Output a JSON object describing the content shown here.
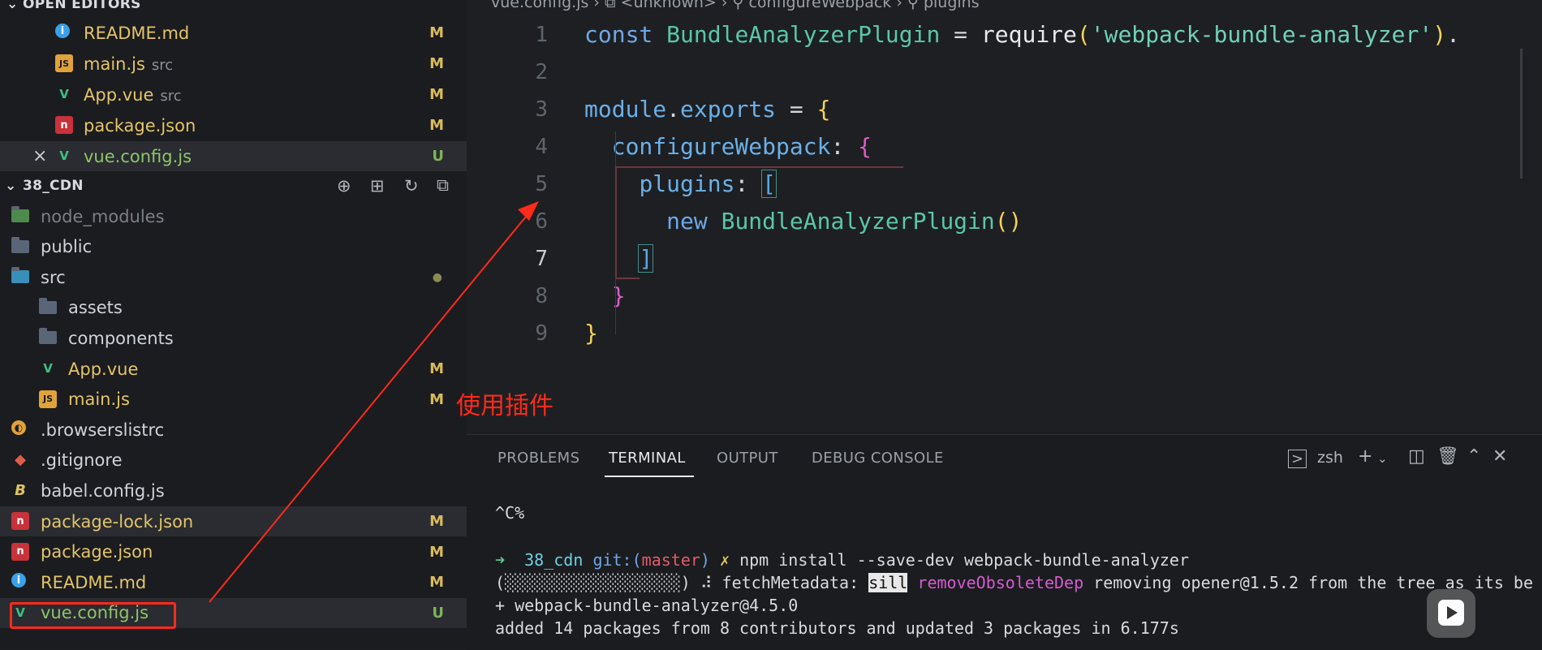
{
  "sidebar": {
    "open_editors_header": "OPEN EDITORS",
    "open_editors": [
      {
        "name": "README.md",
        "sub": "",
        "status": "M",
        "icon": "info-icon"
      },
      {
        "name": "main.js",
        "sub": "src",
        "status": "M",
        "icon": "js-icon"
      },
      {
        "name": "App.vue",
        "sub": "src",
        "status": "M",
        "icon": "vue-icon"
      },
      {
        "name": "package.json",
        "sub": "",
        "status": "M",
        "icon": "npm-icon"
      },
      {
        "name": "vue.config.js",
        "sub": "",
        "status": "U",
        "icon": "vue-icon",
        "close": "×"
      }
    ],
    "project_header": "38_CDN",
    "tree": [
      {
        "name": "node_modules",
        "status": "",
        "icon": "node-folder-icon"
      },
      {
        "name": "public",
        "status": "",
        "icon": "folder-icon"
      },
      {
        "name": "src",
        "status": "●",
        "icon": "src-folder-icon"
      },
      {
        "name": "assets",
        "status": "",
        "icon": "folder-icon"
      },
      {
        "name": "components",
        "status": "",
        "icon": "folder-icon"
      },
      {
        "name": "App.vue",
        "status": "M",
        "icon": "vue-icon"
      },
      {
        "name": "main.js",
        "status": "M",
        "icon": "js-icon"
      },
      {
        "name": ".browserslistrc",
        "status": "",
        "icon": "browserslist-icon"
      },
      {
        "name": ".gitignore",
        "status": "",
        "icon": "git-icon"
      },
      {
        "name": "babel.config.js",
        "status": "",
        "icon": "babel-icon"
      },
      {
        "name": "package-lock.json",
        "status": "M",
        "icon": "npm-lock-icon"
      },
      {
        "name": "package.json",
        "status": "M",
        "icon": "npm-icon"
      },
      {
        "name": "README.md",
        "status": "M",
        "icon": "info-icon"
      },
      {
        "name": "vue.config.js",
        "status": "U",
        "icon": "vue-icon"
      }
    ]
  },
  "editor": {
    "breadcrumb": "vue.config.js  ›  ⧉ <unknown>  ›  ⚲ configureWebpack  ›  ⚲ plugins",
    "line_numbers": [
      "1",
      "2",
      "3",
      "4",
      "5",
      "6",
      "7",
      "8",
      "9"
    ],
    "current_line": "7"
  },
  "annotation": {
    "text": "使用插件"
  },
  "panel": {
    "tabs": [
      "PROBLEMS",
      "TERMINAL",
      "OUTPUT",
      "DEBUG CONSOLE"
    ],
    "active_tab": "TERMINAL",
    "shell": "zsh",
    "terminal": {
      "line1": "^C%",
      "prompt_arrow": "➜",
      "prompt_dir": "38_cdn",
      "prompt_git": "git:(",
      "prompt_branch": "master",
      "prompt_git_close": ")",
      "prompt_x": "✗",
      "command": "npm install --save-dev webpack-bundle-analyzer",
      "progress_prefix": "(░░░░░░░░░░░░░░░░░░)",
      "progress_mid": " ⠼ fetchMetadata: ",
      "sill": "sill",
      "remove_dep": "removeObsoleteDep",
      "progress_rest": " removing opener@1.5.2 from the tree as its be",
      "added_pkg": "+ webpack-bundle-analyzer@4.5.0",
      "summary": "added 14 packages from 8 contributors and updated 3 packages in 6.177s"
    }
  }
}
